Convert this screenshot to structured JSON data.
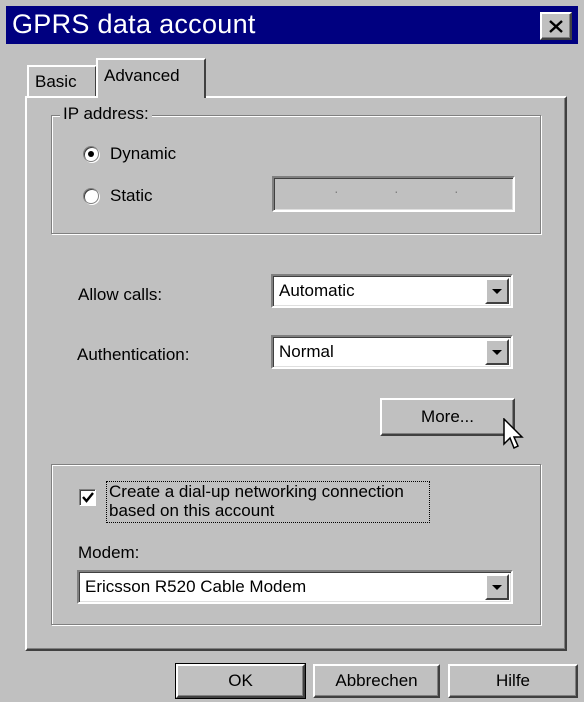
{
  "window": {
    "title": "GPRS data account",
    "close_label": "×"
  },
  "tabs": [
    {
      "label": "Basic",
      "active": false
    },
    {
      "label": "Advanced",
      "active": true
    }
  ],
  "ip_address": {
    "group_label": "IP address:",
    "options": [
      {
        "label": "Dynamic",
        "selected": true
      },
      {
        "label": "Static",
        "selected": false
      }
    ],
    "static_value": ". . ."
  },
  "allow_calls": {
    "label": "Allow calls:",
    "value": "Automatic"
  },
  "authentication": {
    "label": "Authentication:",
    "value": "Normal"
  },
  "more_button": {
    "label": "More..."
  },
  "dialup": {
    "checkbox_label_line1": "Create a dial-up networking connection",
    "checkbox_label_line2": "based on this account",
    "checked": true,
    "modem_label": "Modem:",
    "modem_value": "Ericsson R520 Cable Modem"
  },
  "footer": {
    "ok_label": "OK",
    "cancel_label": "Abbrechen",
    "help_label": "Hilfe"
  },
  "colors": {
    "titlebar": "#000080",
    "face": "#c0c0c0"
  }
}
